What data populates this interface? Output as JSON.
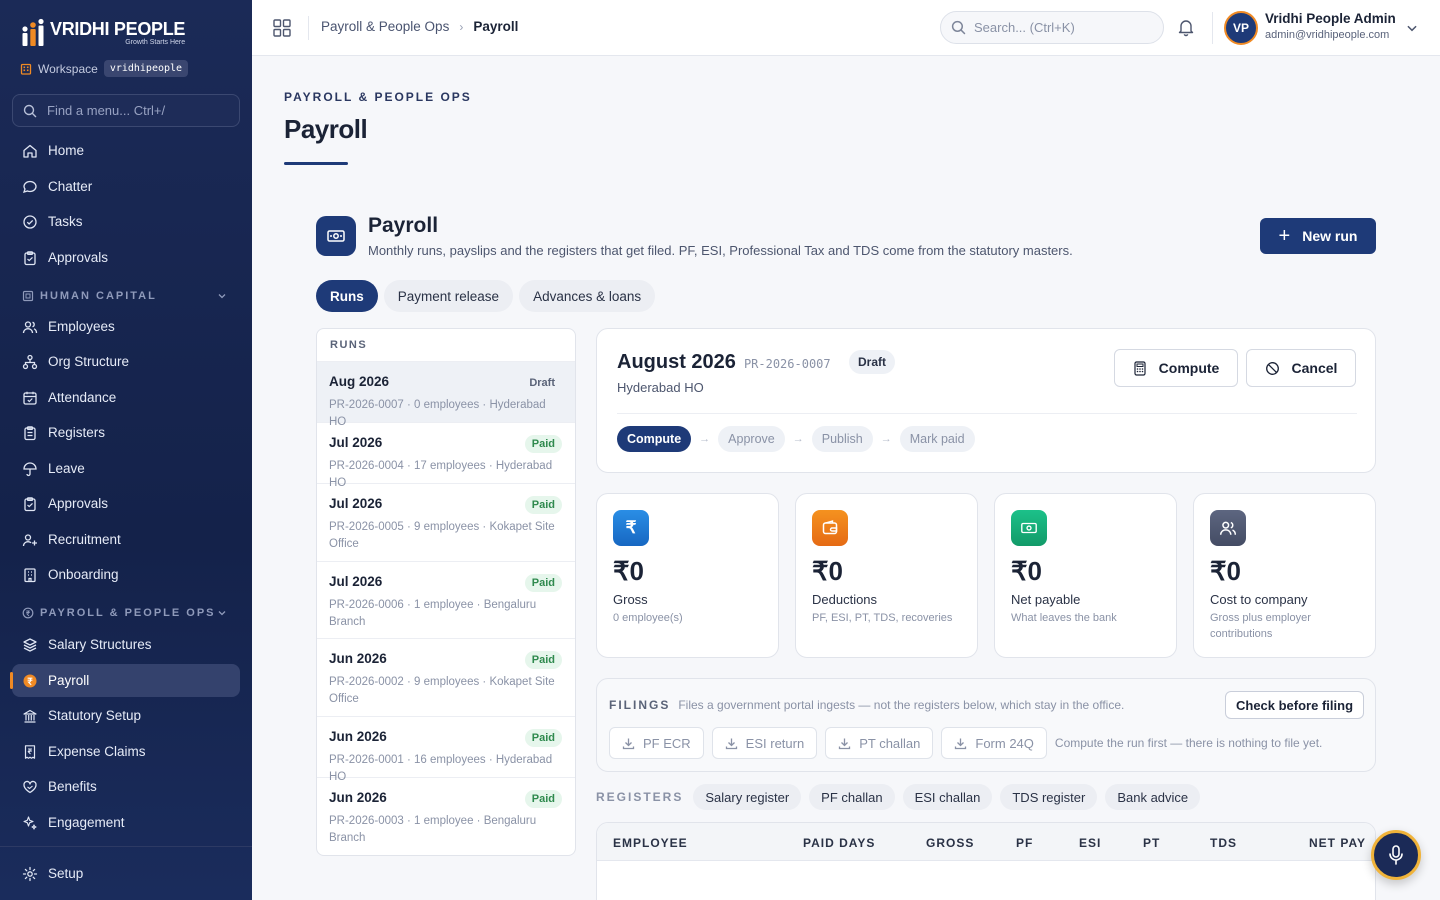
{
  "app": {
    "brand": "VRIDHI PEOPLE",
    "tagline": "Growth Starts Here"
  },
  "workspace": {
    "label": "Workspace",
    "name": "vridhipeople"
  },
  "menu_search": {
    "placeholder": "Find a menu... Ctrl+/"
  },
  "sidebar": {
    "top_items": [
      {
        "label": "Home",
        "icon": "home-icon"
      },
      {
        "label": "Chatter",
        "icon": "chat-icon"
      },
      {
        "label": "Tasks",
        "icon": "check-circle-icon"
      },
      {
        "label": "Approvals",
        "icon": "clipboard-icon"
      }
    ],
    "section1": {
      "title": "HUMAN CAPITAL",
      "items": [
        {
          "label": "Employees"
        },
        {
          "label": "Org Structure"
        },
        {
          "label": "Attendance"
        },
        {
          "label": "Registers"
        },
        {
          "label": "Leave"
        },
        {
          "label": "Approvals"
        },
        {
          "label": "Recruitment"
        },
        {
          "label": "Onboarding"
        }
      ]
    },
    "section2": {
      "title": "PAYROLL & PEOPLE OPS",
      "items": [
        {
          "label": "Salary Structures"
        },
        {
          "label": "Payroll"
        },
        {
          "label": "Statutory Setup"
        },
        {
          "label": "Expense Claims"
        },
        {
          "label": "Benefits"
        },
        {
          "label": "Engagement"
        }
      ]
    },
    "setup": "Setup"
  },
  "topbar": {
    "breadcrumb": {
      "parent": "Payroll & People Ops",
      "current": "Payroll"
    },
    "search_placeholder": "Search...  (Ctrl+K)",
    "user": {
      "initials": "VP",
      "name": "Vridhi People Admin",
      "email": "admin@vridhipeople.com"
    }
  },
  "page": {
    "eyebrow": "PAYROLL & PEOPLE OPS",
    "title": "Payroll"
  },
  "module": {
    "title": "Payroll",
    "subtitle": "Monthly runs, payslips and the registers that get filed. PF, ESI, Professional Tax and TDS come from the statutory masters.",
    "new_run": "New run"
  },
  "tabs": [
    "Runs",
    "Payment release",
    "Advances & loans"
  ],
  "runs": {
    "header": "RUNS",
    "items": [
      {
        "month": "Aug 2026",
        "status": "Draft",
        "desc": "PR-2026-0007 · 0 employees · Hyderabad HO"
      },
      {
        "month": "Jul 2026",
        "status": "Paid",
        "desc": "PR-2026-0004 · 17 employees · Hyderabad HO"
      },
      {
        "month": "Jul 2026",
        "status": "Paid",
        "desc": "PR-2026-0005 · 9 employees · Kokapet Site Office"
      },
      {
        "month": "Jul 2026",
        "status": "Paid",
        "desc": "PR-2026-0006 · 1 employee · Bengaluru Branch"
      },
      {
        "month": "Jun 2026",
        "status": "Paid",
        "desc": "PR-2026-0002 · 9 employees · Kokapet Site Office"
      },
      {
        "month": "Jun 2026",
        "status": "Paid",
        "desc": "PR-2026-0001 · 16 employees · Hyderabad HO"
      },
      {
        "month": "Jun 2026",
        "status": "Paid",
        "desc": "PR-2026-0003 · 1 employee · Bengaluru Branch"
      }
    ]
  },
  "detail": {
    "month": "August 2026",
    "code": "PR-2026-0007",
    "status": "Draft",
    "branch": "Hyderabad HO",
    "compute": "Compute",
    "cancel": "Cancel",
    "steps": [
      "Compute",
      "Approve",
      "Publish",
      "Mark paid"
    ]
  },
  "kpis": [
    {
      "value": "₹0",
      "label": "Gross",
      "sub": "0 employee(s)",
      "color": "#1e7fd6",
      "icon": "rupee-icon"
    },
    {
      "value": "₹0",
      "label": "Deductions",
      "sub": "PF, ESI, PT, TDS, recoveries",
      "color": "#f07a1a",
      "icon": "wallet-icon"
    },
    {
      "value": "₹0",
      "label": "Net payable",
      "sub": "What leaves the bank",
      "color": "#18b07a",
      "icon": "banknote-icon"
    },
    {
      "value": "₹0",
      "label": "Cost to company",
      "sub": "Gross plus employer contributions",
      "color": "#4d566e",
      "icon": "users-icon"
    }
  ],
  "filings": {
    "title": "FILINGS",
    "subtitle": "Files a government portal ingests — not the registers below, which stay in the office.",
    "check": "Check before filing",
    "buttons": [
      "PF ECR",
      "ESI return",
      "PT challan",
      "Form 24Q"
    ],
    "note": "Compute the run first — there is nothing to file yet."
  },
  "registers": {
    "title": "REGISTERS",
    "items": [
      "Salary register",
      "PF challan",
      "ESI challan",
      "TDS register",
      "Bank advice"
    ]
  },
  "table": {
    "columns": [
      "EMPLOYEE",
      "PAID DAYS",
      "GROSS",
      "PF",
      "ESI",
      "PT",
      "TDS",
      "NET PAY"
    ]
  }
}
